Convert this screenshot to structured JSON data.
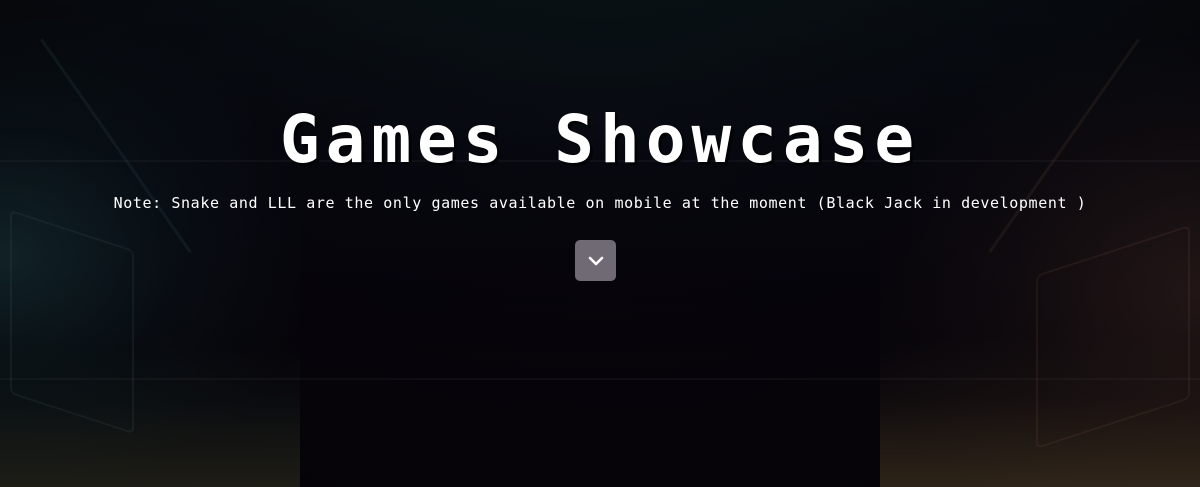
{
  "hero": {
    "title": "Games Showcase",
    "note": "Note: Snake and LLL are the only games available on mobile at the moment (Black Jack in development )"
  },
  "scroll_button": {
    "icon": "chevron-down-icon"
  },
  "colors": {
    "background": "#06050b",
    "text": "#ffffff",
    "button": "#827d87"
  }
}
